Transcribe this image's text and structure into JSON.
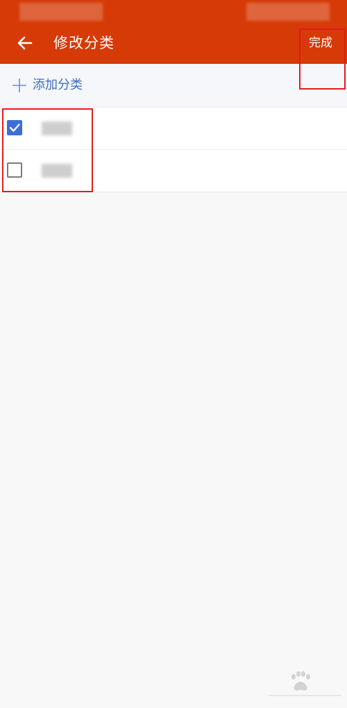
{
  "header": {
    "title": "修改分类",
    "done_label": "完成",
    "back_icon": "arrow-left-icon",
    "background_color": "#d63a06"
  },
  "add_category": {
    "label": "添加分类",
    "icon": "plus-icon",
    "color": "#3f6ec0"
  },
  "categories": [
    {
      "checked": true,
      "label": ""
    },
    {
      "checked": false,
      "label": ""
    }
  ],
  "colors": {
    "checkbox_checked": "#3d6fd9",
    "highlight": "#e21b1b"
  }
}
